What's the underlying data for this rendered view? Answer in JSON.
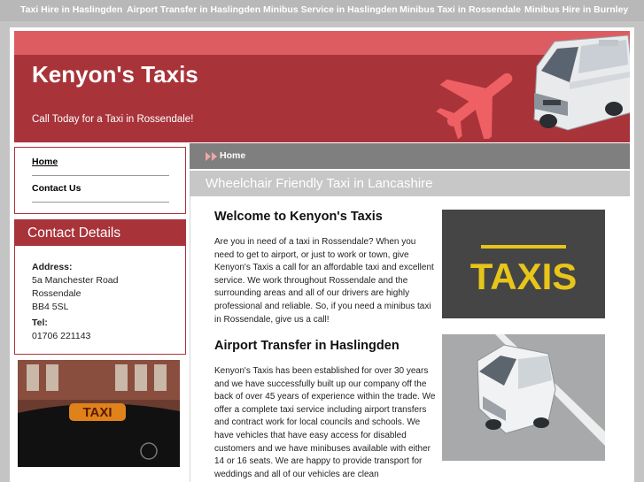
{
  "topnav": {
    "links": [
      "Taxi Hire in Haslingden",
      "Airport Transfer in Haslingden",
      "Minibus Service in Haslingden",
      "Minibus Taxi in Rossendale",
      "Minibus Hire in Burnley"
    ]
  },
  "header": {
    "title": "Kenyon's Taxis",
    "tagline": "Call Today for a Taxi in Rossendale!"
  },
  "sidenav": {
    "items": [
      "Home",
      "Contact Us"
    ]
  },
  "contact": {
    "heading": "Contact Details",
    "address_label": "Address:",
    "address_lines": [
      "5a Manchester Road",
      "Rossendale",
      "BB4 5SL"
    ],
    "tel_label": "Tel:",
    "tel": "01706 221143"
  },
  "breadcrumb": {
    "current": "Home"
  },
  "subheading": "Wheelchair Friendly Taxi in Lancashire",
  "sections": [
    {
      "heading": "Welcome to Kenyon's Taxis",
      "body": "Are you in need of a taxi in Rossendale? When you need to get to airport, or just to work or town, give Kenyon's Taxis a call for an affordable taxi and excellent service. We work throughout Rossendale and the surrounding areas and all of our drivers are highly professional and reliable. So, if you need a minibus taxi in Rossendale, give us a call!"
    },
    {
      "heading": "Airport Transfer in Haslingden",
      "body": "Kenyon's Taxis has been established for over 30 years and we have successfully built up our company off the back of over 45 years of experience within the trade. We offer a complete taxi service including airport transfers and contract work for local councils and schools. We have vehicles that have easy access for disabled customers and we have minibuses available with either 14 or 16 seats. We are happy to provide transport for weddings and all of our vehicles are clean"
    }
  ],
  "images": {
    "road_text": "TAXIS",
    "sign_text": "TAXI"
  },
  "colors": {
    "brand_red": "#a8343a",
    "strip_red": "#dd5c62",
    "nav_grey": "#b8b8b8"
  }
}
